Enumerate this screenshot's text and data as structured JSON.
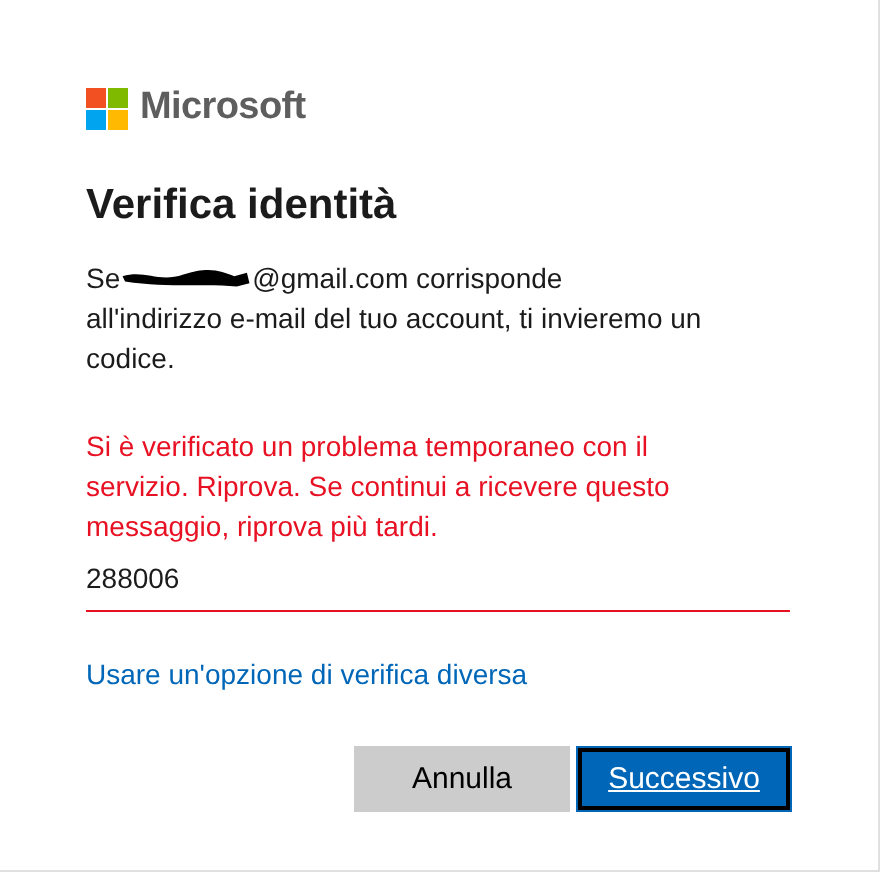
{
  "brand": {
    "name": "Microsoft"
  },
  "title": "Verifica identità",
  "intro": {
    "before": "Se",
    "after": "@gmail.com corrisponde",
    "rest": "all'indirizzo e-mail del tuo account, ti invieremo un codice."
  },
  "error": "Si è verificato un problema temporaneo con il servizio. Riprova. Se continui a ricevere questo messaggio, riprova più tardi.",
  "code_field": {
    "value": "288006",
    "invalid": true
  },
  "link": "Usare un'opzione di verifica diversa",
  "buttons": [
    {
      "label": "Annulla",
      "kind": "secondary"
    },
    {
      "label": "Successivo",
      "kind": "primary"
    }
  ]
}
